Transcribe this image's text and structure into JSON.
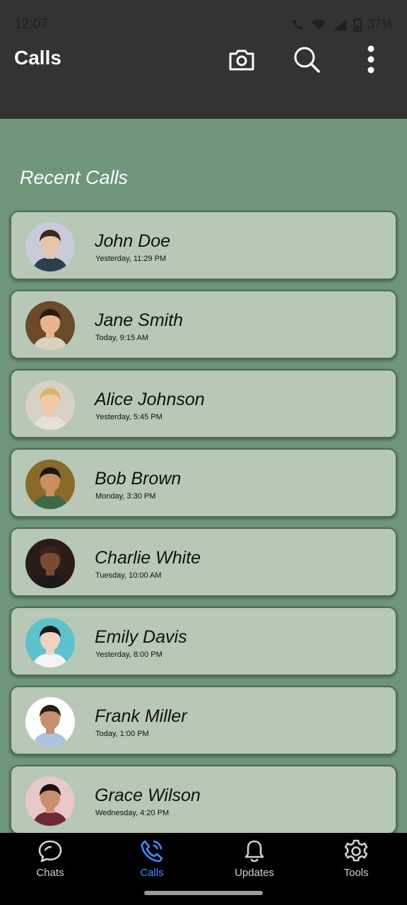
{
  "status": {
    "time": "12:07",
    "battery": "37%"
  },
  "appbar": {
    "title": "Calls",
    "icons": [
      "camera-icon",
      "search-icon",
      "more-vertical-icon"
    ]
  },
  "section": {
    "title": "Recent Calls"
  },
  "calls": [
    {
      "name": "John Doe",
      "time": "Yesterday, 11:29 PM",
      "avatar_colors": {
        "bg": "#c9ccd8",
        "skin": "#e8c4a8",
        "hair": "#3a2a22",
        "shirt": "#2c3e50"
      }
    },
    {
      "name": "Jane Smith",
      "time": "Today, 9:15 AM",
      "avatar_colors": {
        "bg": "#6b4a2c",
        "skin": "#e7b48c",
        "hair": "#2a1a10",
        "shirt": "#d8d0c0"
      }
    },
    {
      "name": "Alice Johnson",
      "time": "Yesterday, 5:45 PM",
      "avatar_colors": {
        "bg": "#d6d2c4",
        "skin": "#f0c9a8",
        "hair": "#d9b56a",
        "shirt": "#e6e1d2"
      }
    },
    {
      "name": "Bob Brown",
      "time": "Monday, 3:30 PM",
      "avatar_colors": {
        "bg": "#8a6a2a",
        "skin": "#c89060",
        "hair": "#1e1410",
        "shirt": "#3f6a4a"
      }
    },
    {
      "name": "Charlie White",
      "time": "Tuesday, 10:00 AM",
      "avatar_colors": {
        "bg": "#2a1c18",
        "skin": "#7a4a32",
        "hair": "#3a2418",
        "shirt": "#1a1a1a"
      }
    },
    {
      "name": "Emily Davis",
      "time": "Yesterday, 8:00 PM",
      "avatar_colors": {
        "bg": "#5cc2cc",
        "skin": "#f0d2c0",
        "hair": "#1a1a1a",
        "shirt": "#f4f4f4"
      }
    },
    {
      "name": "Frank Miller",
      "time": "Today, 1:00 PM",
      "avatar_colors": {
        "bg": "#ffffff",
        "skin": "#c89070",
        "hair": "#2a2018",
        "shirt": "#a8c4e0"
      }
    },
    {
      "name": "Grace Wilson",
      "time": "Wednesday, 4:20 PM",
      "avatar_colors": {
        "bg": "#e8c8c8",
        "skin": "#c8906c",
        "hair": "#1a1010",
        "shirt": "#6a2a3a"
      }
    }
  ],
  "nav": [
    {
      "label": "Chats",
      "icon": "chat-bubble-icon",
      "active": false
    },
    {
      "label": "Calls",
      "icon": "phone-icon",
      "active": true
    },
    {
      "label": "Updates",
      "icon": "bell-icon",
      "active": false
    },
    {
      "label": "Tools",
      "icon": "gear-icon",
      "active": false
    }
  ],
  "colors": {
    "appbar": "#333333",
    "background": "#6f957a",
    "card": "#b7c8b7",
    "nav_active": "#3f8cff"
  }
}
